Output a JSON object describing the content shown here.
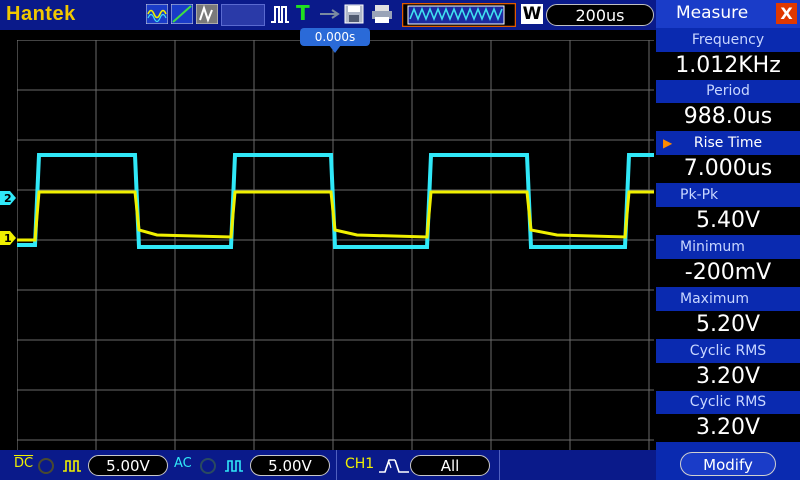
{
  "top_bar": {
    "brand": "Hantek",
    "timebase": "200us",
    "trigger_position": "0.000s",
    "colors": {
      "bar": "#0a1a8a",
      "brand": "#f0c800"
    }
  },
  "channels": [
    {
      "id": "1",
      "color": "#f0f000",
      "coupling": "DC",
      "volts_per_div": "5.00V"
    },
    {
      "id": "2",
      "color": "#40e0f0",
      "coupling": "AC",
      "volts_per_div": "5.00V"
    }
  ],
  "trigger": {
    "source": "CH1",
    "mode": "All"
  },
  "measure_panel": {
    "title": "Measure",
    "close_label": "X",
    "items": [
      {
        "label": "Frequency",
        "value": "1.012KHz"
      },
      {
        "label": "Period",
        "value": "988.0us"
      },
      {
        "label": "Rise Time",
        "value": "7.000us",
        "selected": true
      },
      {
        "label": "Pk-Pk",
        "value": "5.40V"
      },
      {
        "label": "Minimum",
        "value": "-200mV"
      },
      {
        "label": "Maximum",
        "value": "5.20V"
      },
      {
        "label": "Cyclic RMS",
        "value": "3.20V"
      },
      {
        "label": "Cyclic RMS",
        "value": "3.20V"
      }
    ],
    "modify_label": "Modify"
  },
  "icons": [
    "waveform-icon",
    "trigger-icon",
    "pulse-icon",
    "t-icon",
    "usb-icon",
    "save-icon",
    "printer-icon",
    "memory-depth-icon",
    "w-icon"
  ]
}
